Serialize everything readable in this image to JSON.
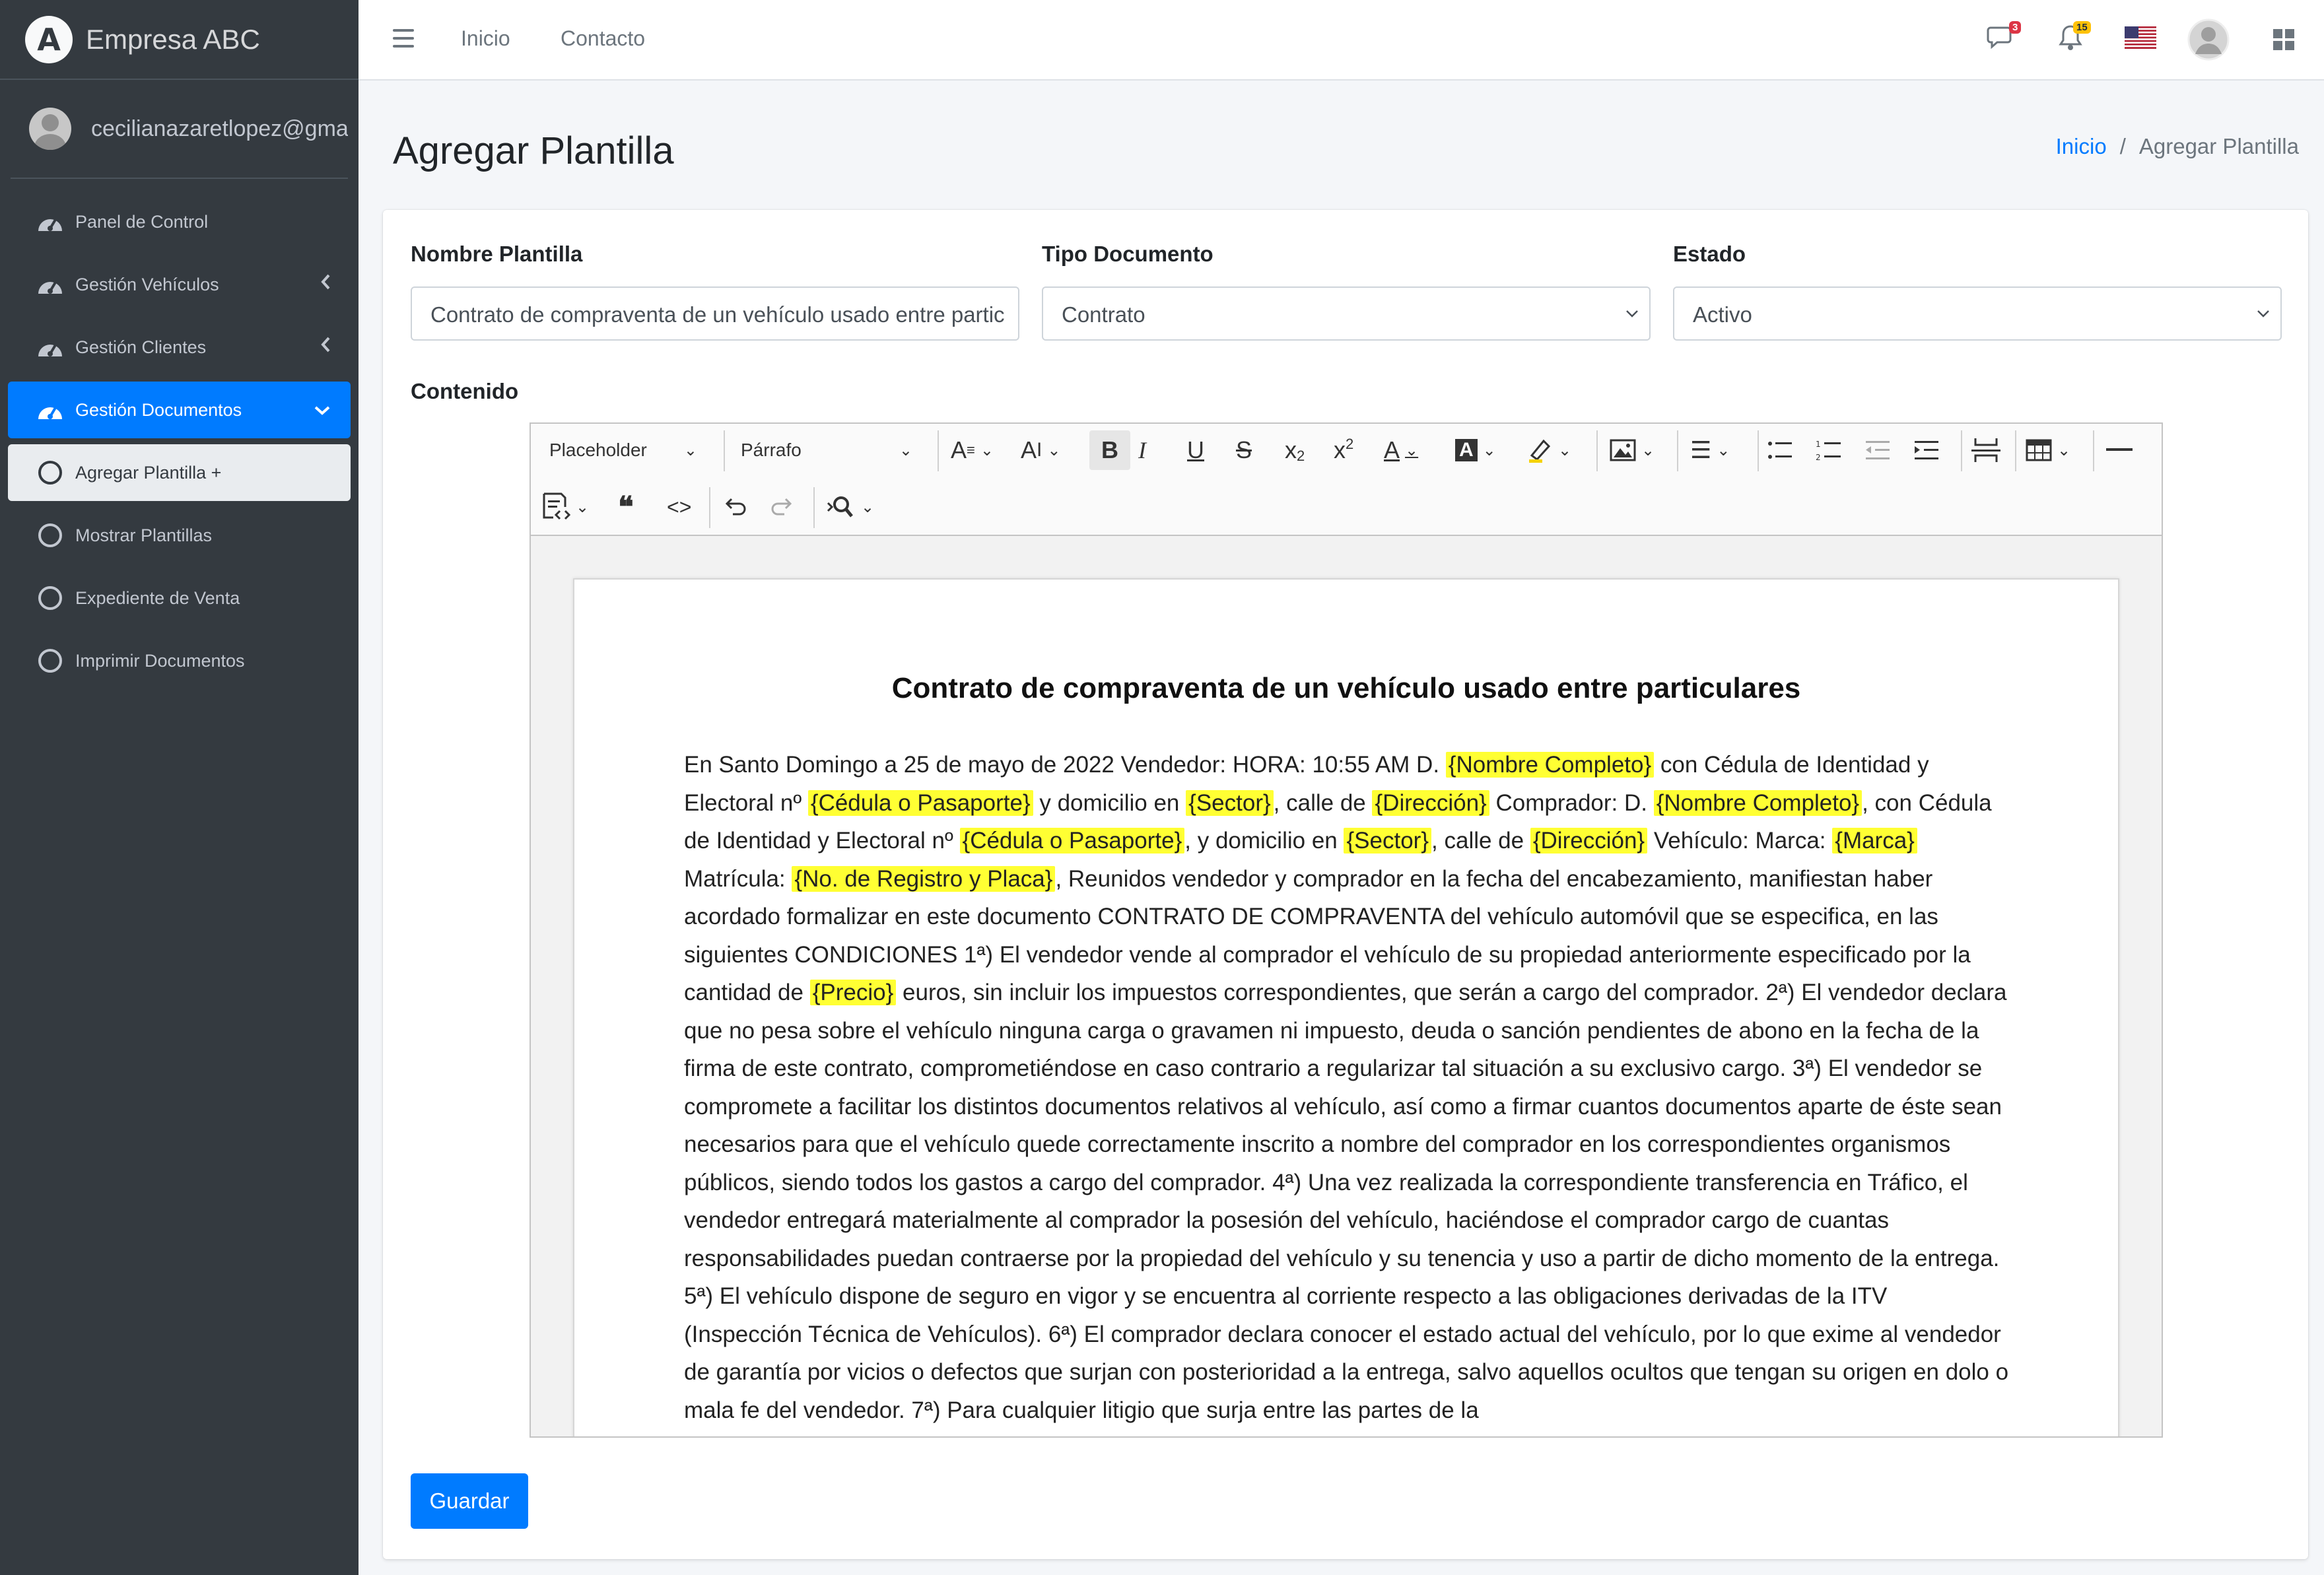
{
  "brand": {
    "name": "Empresa ABC",
    "logo_letter": "A"
  },
  "user": {
    "email": "cecilianazaretlopez@gmail"
  },
  "sidebar": {
    "items": [
      {
        "label": "Panel de Control",
        "icon": "dashboard-gauge-icon"
      },
      {
        "label": "Gestión Vehículos",
        "icon": "dashboard-gauge-icon",
        "chevron": "‹"
      },
      {
        "label": "Gestión Clientes",
        "icon": "dashboard-gauge-icon",
        "chevron": "‹"
      },
      {
        "label": "Gestión Documentos",
        "icon": "dashboard-gauge-icon",
        "chevron": "⌄"
      },
      {
        "label": "Agregar Plantilla +",
        "icon": "circle-icon"
      },
      {
        "label": "Mostrar Plantillas",
        "icon": "circle-icon"
      },
      {
        "label": "Expediente de Venta",
        "icon": "circle-icon"
      },
      {
        "label": "Imprimir Documentos",
        "icon": "circle-icon"
      }
    ]
  },
  "topnav": {
    "links": [
      "Inicio",
      "Contacto"
    ],
    "messages_badge": "3",
    "notifications_badge": "15"
  },
  "page": {
    "title": "Agregar Plantilla",
    "breadcrumb": {
      "home": "Inicio",
      "separator": "/",
      "current": "Agregar Plantilla"
    }
  },
  "form": {
    "nombre_label": "Nombre Plantilla",
    "nombre_value": "Contrato de compraventa de un vehículo usado entre partic",
    "tipo_label": "Tipo Documento",
    "tipo_value": "Contrato",
    "estado_label": "Estado",
    "estado_value": "Activo",
    "contenido_label": "Contenido",
    "save_label": "Guardar"
  },
  "editor": {
    "placeholder_dropdown": "Placeholder",
    "heading_dropdown": "Párrafo",
    "doc_title": "Contrato de compraventa de un vehículo usado entre particulares",
    "body": [
      {
        "t": "En Santo Domingo a 25 de mayo de 2022  Vendedor: HORA: 10:55 AM D. "
      },
      {
        "t": "{Nombre Completo}",
        "ph": true
      },
      {
        "t": " con Cédula de Identidad y Electoral nº "
      },
      {
        "t": "{Cédula o Pasaporte}",
        "ph": true
      },
      {
        "t": " y domicilio en "
      },
      {
        "t": "{Sector}",
        "ph": true
      },
      {
        "t": ", calle de "
      },
      {
        "t": "{Dirección}",
        "ph": true
      },
      {
        "t": " Comprador: D. "
      },
      {
        "t": "{Nombre Completo}",
        "ph": true
      },
      {
        "t": ", con Cédula de Identidad y Electoral nº "
      },
      {
        "t": "{Cédula o Pasaporte}",
        "ph": true
      },
      {
        "t": ", y domicilio en "
      },
      {
        "t": "{Sector}",
        "ph": true
      },
      {
        "t": ", calle de "
      },
      {
        "t": "{Dirección}",
        "ph": true
      },
      {
        "t": " Vehículo: Marca: "
      },
      {
        "t": "{Marca}",
        "ph": true
      },
      {
        "t": " Matrícula: "
      },
      {
        "t": "{No. de Registro y Placa}",
        "ph": true
      },
      {
        "t": ", Reunidos vendedor y comprador en la fecha del encabezamiento, manifiestan haber acordado formalizar en este documento CONTRATO DE COMPRAVENTA del vehículo automóvil que se especifica, en las siguientes CONDICIONES 1ª) El vendedor vende al comprador el vehículo de su propiedad anteriormente especificado por la cantidad de "
      },
      {
        "t": "{Precio}",
        "ph": true
      },
      {
        "t": " euros, sin incluir los impuestos correspondientes, que serán a cargo del comprador. 2ª) El vendedor declara que no pesa sobre el vehículo ninguna carga o gravamen ni impuesto, deuda o sanción pendientes de abono en la fecha de la firma de este contrato, comprometiéndose en caso contrario a regularizar tal situación a su exclusivo cargo. 3ª) El vendedor se compromete a facilitar los distintos documentos relativos al vehículo, así como a firmar cuantos documentos aparte de éste sean necesarios para que el vehículo quede correctamente inscrito a nombre del comprador en los correspondientes organismos públicos, siendo todos los gastos a cargo del comprador. 4ª) Una vez realizada la correspondiente transferencia en Tráfico, el vendedor entregará materialmente al comprador la posesión del vehículo, haciéndose el comprador cargo de cuantas responsabilidades puedan contraerse por la propiedad del vehículo y su tenencia y uso a partir de dicho momento de la entrega. 5ª) El vehículo dispone de seguro en vigor y se encuentra al corriente respecto a las obligaciones derivadas de la ITV (Inspección Técnica de Vehículos). 6ª) El comprador declara conocer el estado actual del vehículo, por lo que exime al vendedor de garantía por vicios o defectos que surjan con posterioridad a la entrega, salvo aquellos ocultos que tengan su origen en dolo o mala fe del vendedor. 7ª) Para cualquier litigio que surja entre las partes de la"
      }
    ]
  },
  "colors": {
    "sidebar_bg": "#343a40",
    "primary": "#007bff",
    "highlight": "#ffff33",
    "messages_badge": "#dc3545",
    "notifications_badge": "#ffc107"
  }
}
